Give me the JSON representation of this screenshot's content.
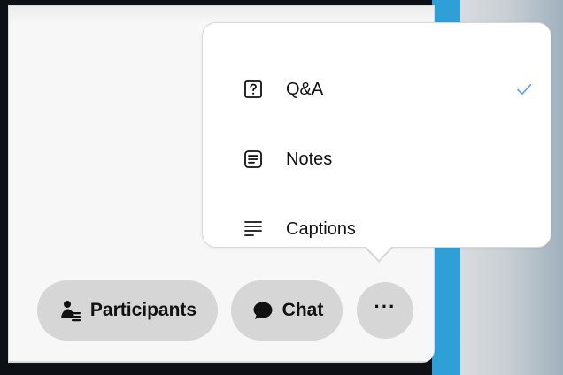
{
  "menu": {
    "items": [
      {
        "label": "Q&A",
        "icon": "question-box-icon",
        "checked": true
      },
      {
        "label": "Notes",
        "icon": "note-icon",
        "checked": false
      },
      {
        "label": "Captions",
        "icon": "captions-icon",
        "checked": false
      }
    ]
  },
  "toolbar": {
    "participants_label": "Participants",
    "chat_label": "Chat",
    "more_label": "···"
  },
  "colors": {
    "accent": "#2f9fd7",
    "window_bg": "#f7f7f7",
    "pill_bg": "#d6d6d6",
    "popover_bg": "#ffffff",
    "check": "#63a7e8"
  }
}
